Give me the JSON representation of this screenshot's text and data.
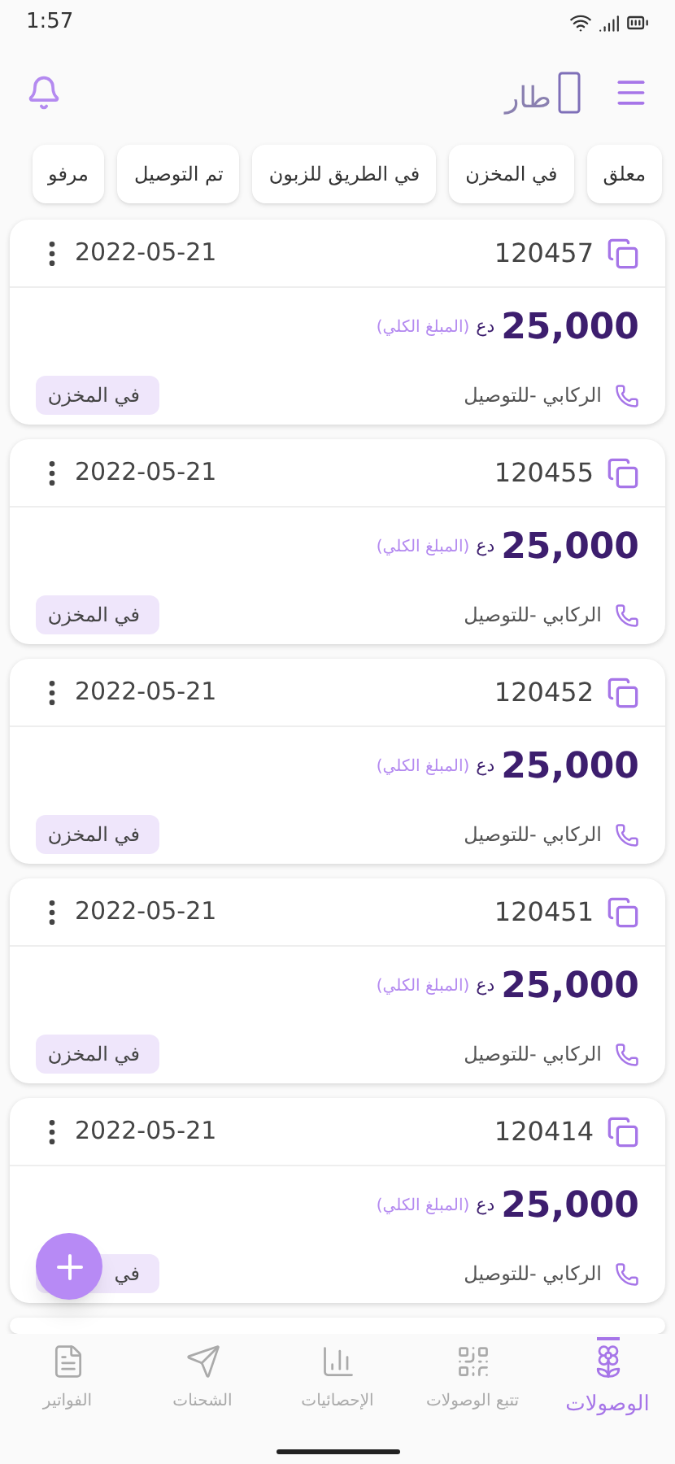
{
  "status_bar": {
    "time": "1:57"
  },
  "header": {
    "logo": "طار"
  },
  "filters": [
    {
      "label": "معلق",
      "selected": false
    },
    {
      "label": "في المخزن",
      "selected": false
    },
    {
      "label": "في الطريق للزبون",
      "selected": false
    },
    {
      "label": "تم التوصيل",
      "selected": false
    },
    {
      "label": "مرفو",
      "selected": false
    }
  ],
  "receipts": [
    {
      "number": "120457",
      "date": "2022-05-21",
      "amount": "25,000",
      "currency": "دع",
      "amount_label": "(المبلغ الكلي)",
      "contact": "الركابي -للتوصيل",
      "status": "في المخزن"
    },
    {
      "number": "120455",
      "date": "2022-05-21",
      "amount": "25,000",
      "currency": "دع",
      "amount_label": "(المبلغ الكلي)",
      "contact": "الركابي -للتوصيل",
      "status": "في المخزن"
    },
    {
      "number": "120452",
      "date": "2022-05-21",
      "amount": "25,000",
      "currency": "دع",
      "amount_label": "(المبلغ الكلي)",
      "contact": "الركابي -للتوصيل",
      "status": "في المخزن"
    },
    {
      "number": "120451",
      "date": "2022-05-21",
      "amount": "25,000",
      "currency": "دع",
      "amount_label": "(المبلغ الكلي)",
      "contact": "الركابي -للتوصيل",
      "status": "في المخزن"
    },
    {
      "number": "120414",
      "date": "2022-05-21",
      "amount": "25,000",
      "currency": "دع",
      "amount_label": "(المبلغ الكلي)",
      "contact": "الركابي -للتوصيل",
      "status": "في"
    }
  ],
  "bottom_nav": [
    {
      "label": "الوصولات",
      "kind": "flower",
      "selected": true
    },
    {
      "label": "تتبع الوصولات",
      "kind": "qr",
      "selected": false
    },
    {
      "label": "الإحصائيات",
      "kind": "chart",
      "selected": false
    },
    {
      "label": "الشحنات",
      "kind": "send",
      "selected": false
    },
    {
      "label": "الفواتير",
      "kind": "file",
      "selected": false
    }
  ]
}
